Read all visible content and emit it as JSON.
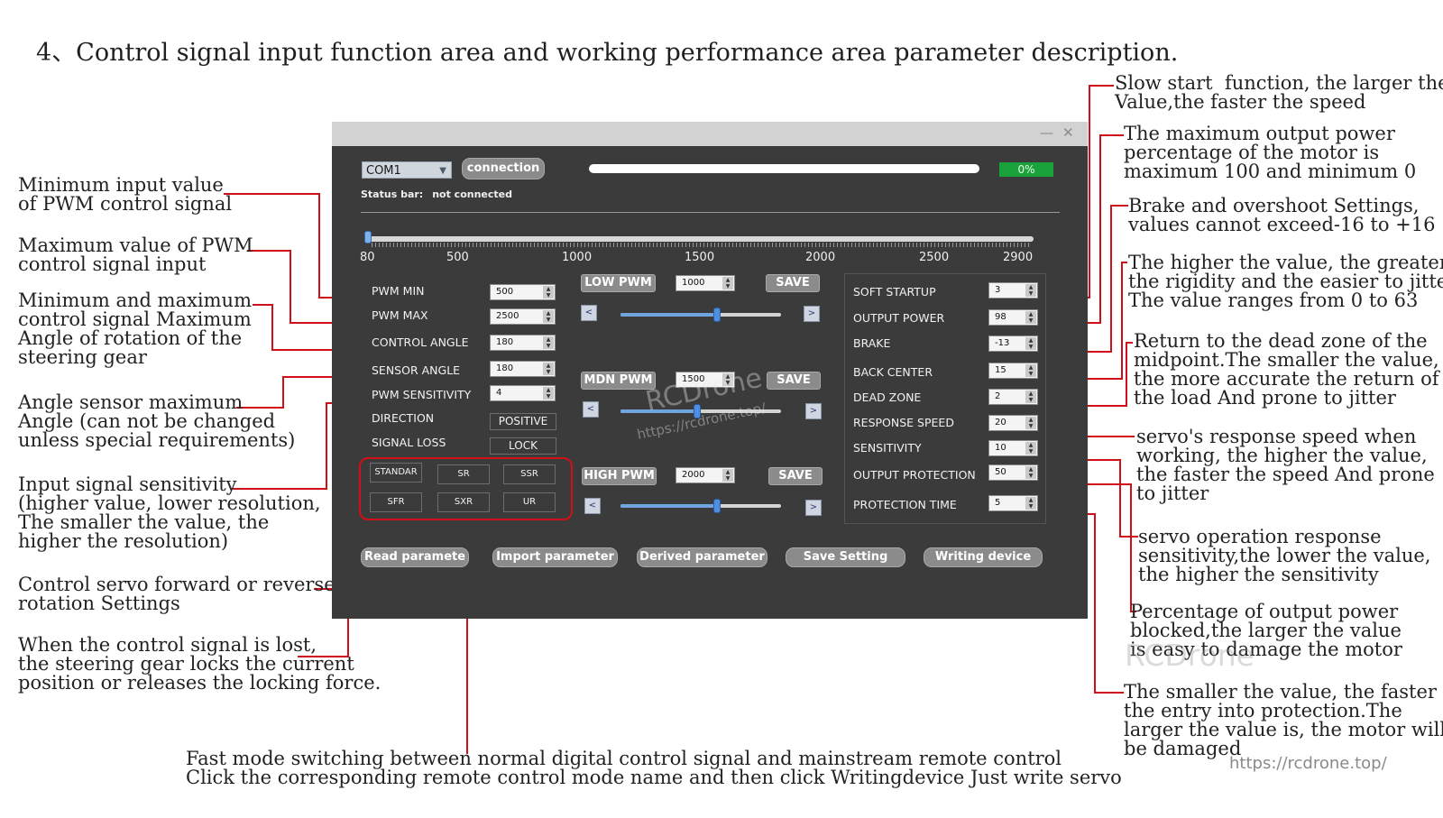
{
  "heading": "4、Control signal input function area and working performance area parameter description.",
  "window": {
    "title_controls": [
      "—",
      "✕"
    ],
    "port": "COM1",
    "connect_label": "connection",
    "progress_percent": 0,
    "progress_label": "0%",
    "status_label": "Status bar:",
    "status_value": "not connected",
    "scale": [
      "80",
      "500",
      "1000",
      "1500",
      "2000",
      "2500",
      "2900"
    ],
    "slider_value": 80,
    "left_params": [
      {
        "label": "PWM MIN",
        "value": "500"
      },
      {
        "label": "PWM MAX",
        "value": "2500"
      },
      {
        "label": "CONTROL ANGLE",
        "value": "180"
      },
      {
        "label": "SENSOR ANGLE",
        "value": "180"
      },
      {
        "label": "PWM SENSITIVITY",
        "value": "4"
      }
    ],
    "direction": {
      "label": "DIRECTION",
      "value": "POSITIVE"
    },
    "signal_loss": {
      "label": "SIGNAL LOSS",
      "value": "LOCK"
    },
    "modes": [
      "STANDAR",
      "SR",
      "SSR",
      "SFR",
      "SXR",
      "UR"
    ],
    "pwm_rows": [
      {
        "label": "LOW PWM",
        "value": "1000",
        "save": "SAVE",
        "level": 0.6
      },
      {
        "label": "MDN PWM",
        "value": "1500",
        "save": "SAVE",
        "level": 0.48
      },
      {
        "label": "HIGH PWM",
        "value": "2000",
        "save": "SAVE",
        "level": 0.6
      }
    ],
    "arrow_left": "<",
    "arrow_right": ">",
    "right_params": [
      {
        "label": "SOFT STARTUP",
        "value": "3"
      },
      {
        "label": "OUTPUT POWER",
        "value": "98"
      },
      {
        "label": "BRAKE",
        "value": "-13"
      },
      {
        "label": "BACK CENTER",
        "value": "15"
      },
      {
        "label": "DEAD ZONE",
        "value": "2"
      },
      {
        "label": "RESPONSE SPEED",
        "value": "20"
      },
      {
        "label": "SENSITIVITY",
        "value": "10"
      },
      {
        "label": "OUTPUT PROTECTION",
        "value": "50"
      },
      {
        "label": "PROTECTION TIME",
        "value": "5"
      }
    ],
    "bottom_buttons": [
      "Read paramete",
      "Import parameter",
      "Derived parameter",
      "Save Setting",
      "Writing device"
    ]
  },
  "left_notes": [
    "Minimum input value\nof PWM control signal",
    "Maximum value of PWM\ncontrol signal input",
    "Minimum and maximum\ncontrol signal Maximum\nAngle of rotation of the\nsteering gear",
    "Angle sensor maximum\nAngle (can not be changed\nunless special requirements)",
    "Input signal sensitivity\n(higher value, lower resolution,\nThe smaller the value, the\nhigher the resolution)",
    "Control servo forward or reverse\nrotation Settings",
    "When the control signal is lost,\nthe steering gear locks the current\nposition or releases the locking force."
  ],
  "right_notes": [
    "Slow start  function, the larger the\nValue,the faster the speed",
    "The maximum output power\npercentage of the motor is\nmaximum 100 and minimum 0",
    "Brake and overshoot Settings,\nvalues cannot exceed-16 to +16",
    "The higher the value, the greater\nthe rigidity and the easier to jitter\nThe value ranges from 0 to 63",
    "Return to the dead zone of the\nmidpoint.The smaller the value,\nthe more accurate the return of\nthe load And prone to jitter",
    "servo's response speed when\nworking, the higher the value,\nthe faster the speed And prone\nto jitter",
    "servo operation response\nsensitivity,the lower the value,\nthe higher the sensitivity",
    "Percentage of output power\nblocked,the larger the value\nis easy to damage the motor",
    "The smaller the value, the faster\nthe entry into protection.The\nlarger the value is, the motor will\nbe damaged"
  ],
  "bottom_note": "Fast mode switching between normal digital control signal and mainstream remote control\nClick the corresponding remote control mode name and then click Writingdevice Just write servo",
  "watermarks": {
    "brand": "RCDrone",
    "url": "https://rcdrone.top/"
  },
  "colors": {
    "callout_line": "#d10f19",
    "window_bg": "#3b3b3b",
    "progress_green": "#19a33a"
  }
}
